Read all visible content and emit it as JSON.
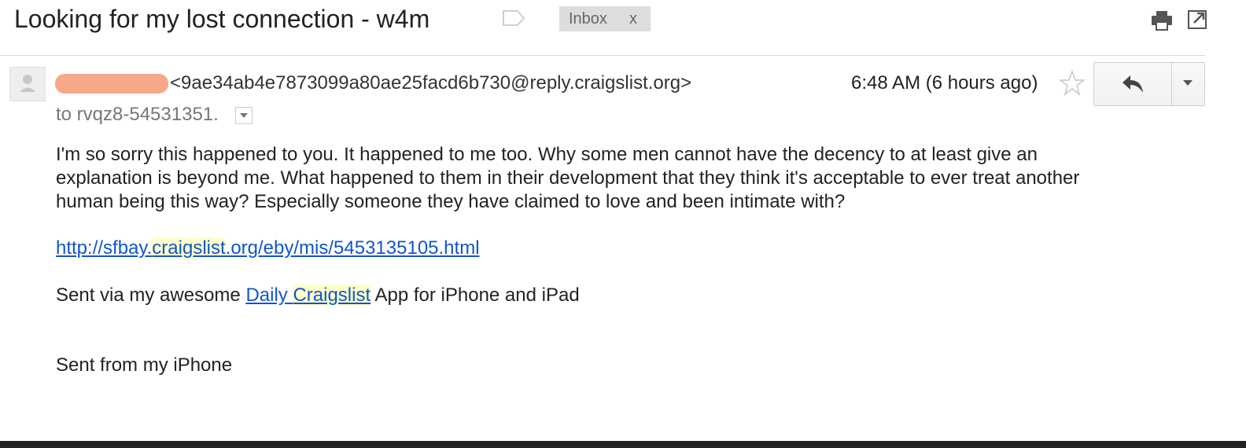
{
  "thread": {
    "subject": "Looking for my lost connection - w4m",
    "label": {
      "name": "Inbox",
      "remove": "x"
    }
  },
  "toolbar": {
    "print_icon": "print-icon",
    "popout_icon": "new-window-icon"
  },
  "message": {
    "sender_email": "<9ae34ab4e7873099a80ae25facd6b730@reply.craigslist.org>",
    "time": "6:48 AM (6 hours ago)",
    "recipient": "to rvqz8-54531351.",
    "body": {
      "line1": "I'm so sorry this happened to you.  It happened to me too.  Why some men cannot have the decency to at least give an",
      "line2": "explanation is beyond me.  What happened to them in their development that they think it's acceptable to ever treat another",
      "line3": "human being this way?  Especially someone they have claimed to love and been intimate with?",
      "link": {
        "prefix": "http://sfbay.",
        "highlight": "craigslist",
        "suffix": ".org/eby/mis/5453135105.html"
      },
      "app_line": {
        "before": "Sent via my awesome ",
        "link_word1": "Daily ",
        "link_word2": "Craigslist",
        "after": " App for iPhone and iPad"
      },
      "signature": "Sent from my iPhone"
    }
  },
  "colors": {
    "link": "#1155cc",
    "highlight": "#ffffcc",
    "redaction": "#f6a889",
    "chip": "#dddddd"
  }
}
